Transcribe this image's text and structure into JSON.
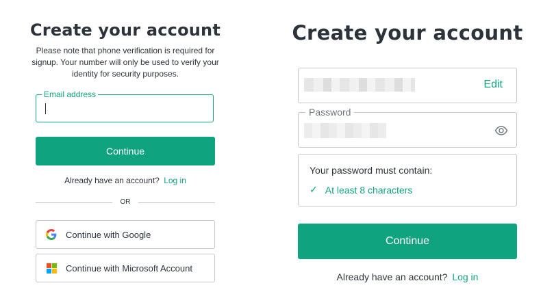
{
  "colors": {
    "accent": "#10a37f",
    "text": "#2d333a",
    "border": "#c2c8d0"
  },
  "left": {
    "title": "Create your account",
    "notice": "Please note that phone verification is required for signup. Your number will only be used to verify your identity for security purposes.",
    "email_label": "Email address",
    "email_value": "",
    "continue_label": "Continue",
    "already_text": "Already have an account?",
    "login_link": "Log in",
    "or_text": "OR",
    "google_label": "Continue with Google",
    "google_icon": "google-icon",
    "microsoft_label": "Continue with Microsoft Account",
    "microsoft_icon": "microsoft-icon"
  },
  "right": {
    "title": "Create your account",
    "edit_link": "Edit",
    "password_label": "Password",
    "password_icon": "eye-icon",
    "requirements_title": "Your password must contain:",
    "requirement_check": "✓",
    "requirement_1": "At least 8 characters",
    "continue_label": "Continue",
    "already_text": "Already have an account?",
    "login_link": "Log in"
  }
}
